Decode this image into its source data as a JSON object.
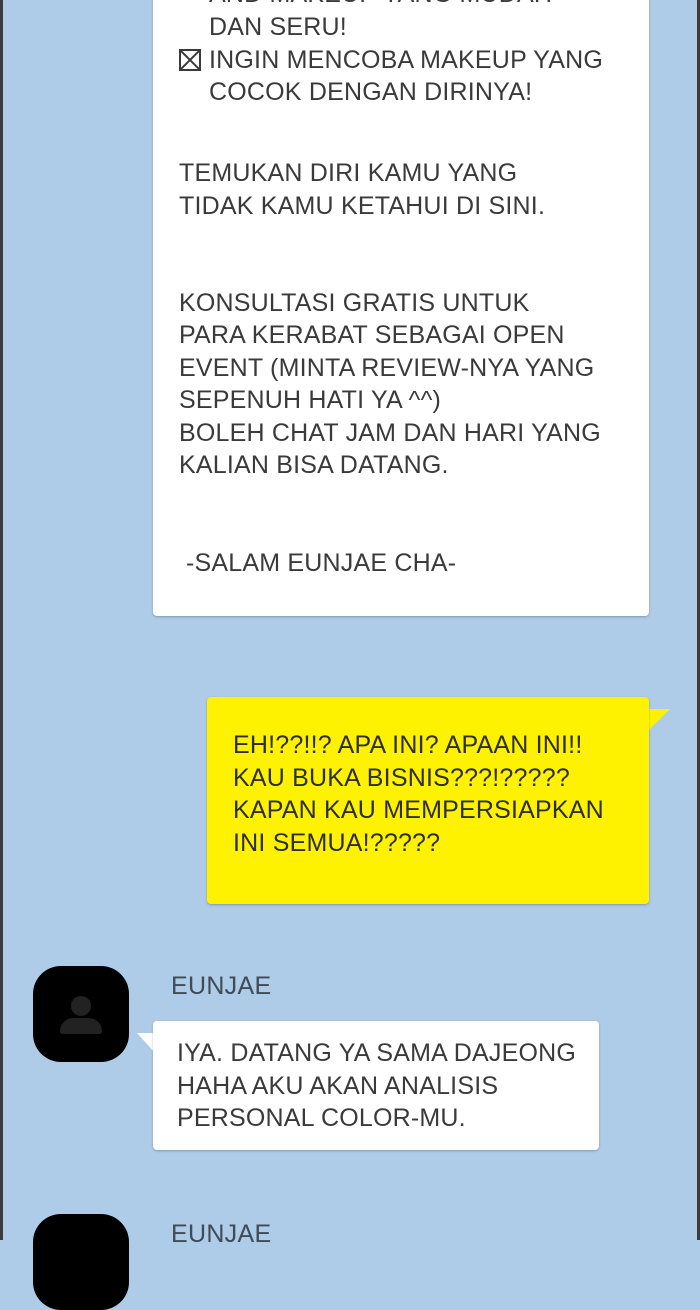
{
  "chat": {
    "incoming_top": {
      "lines_cropped": [
        "AND MAKEUP YANG MUDAH",
        "DAN SERU!"
      ],
      "checkbox_item_line1": "INGIN MENCOBA MAKEUP YANG",
      "checkbox_item_line2": "COCOK DENGAN DIRINYA!",
      "para2_line1": "TEMUKAN DIRI KAMU YANG",
      "para2_line2": "TIDAK KAMU KETAHUI DI SINI.",
      "para3_line1": "KONSULTASI GRATIS UNTUK",
      "para3_line2": "PARA KERABAT SEBAGAI OPEN",
      "para3_line3": "EVENT (MINTA REVIEW-NYA YANG",
      "para3_line4": "SEPENUH HATI YA ^^)",
      "para3_line5": "BOLEH CHAT JAM DAN HARI YANG",
      "para3_line6": "KALIAN BISA DATANG.",
      "signature": "-SALAM EUNJAE CHA-"
    },
    "outgoing": {
      "text": "EH!??!!? APA INI? APAAN INI!!\nKAU BUKA BISNIS???!?????\nKAPAN KAU MEMPERSIAPKAN\nINI SEMUA!?????"
    },
    "incoming_reply": {
      "sender": "EUNJAE",
      "text": "IYA. DATANG YA SAMA DAJEONG\nHAHA AKU AKAN ANALISIS\nPERSONAL COLOR-MU."
    },
    "incoming_next": {
      "sender": "EUNJAE"
    }
  },
  "colors": {
    "background": "#aecbe7",
    "outgoing_bubble": "#fff200",
    "incoming_bubble": "#ffffff"
  },
  "icons": {
    "checkbox": "checkbox-crossed-icon",
    "avatar": "default-user-avatar-icon"
  }
}
